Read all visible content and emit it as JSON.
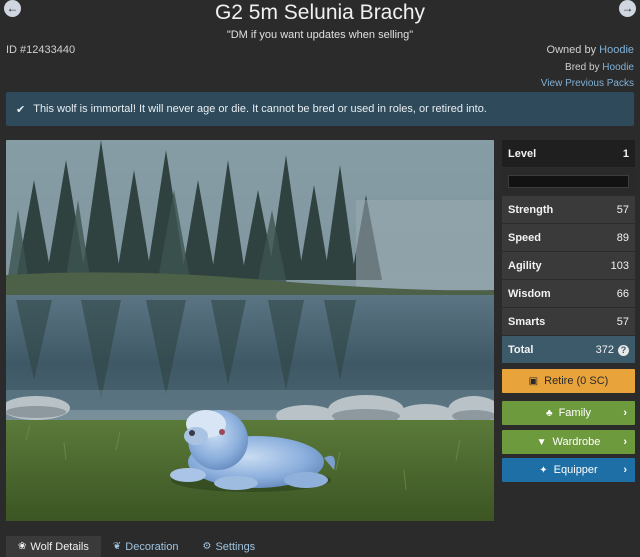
{
  "header": {
    "title": "G2 5m Selunia Brachy",
    "subtitle": "\"DM if you want updates when selling\"",
    "id_label": "ID #12433440",
    "owned_by_label": "Owned by",
    "owned_by_user": "Hoodie",
    "bred_by_label": "Bred by",
    "bred_by_user": "Hoodie",
    "previous_packs_link": "View Previous Packs",
    "prev_icon": "left-arrow-circle-icon",
    "next_icon": "right-arrow-circle-icon"
  },
  "alert": {
    "icon": "check-icon",
    "text": "This wolf is immortal! It will never age or die. It cannot be bred or used in roles, or retired into."
  },
  "stats": {
    "level_label": "Level",
    "level_value": "1",
    "xp_progress": 0,
    "strength_label": "Strength",
    "strength_value": "57",
    "speed_label": "Speed",
    "speed_value": "89",
    "agility_label": "Agility",
    "agility_value": "103",
    "wisdom_label": "Wisdom",
    "wisdom_value": "66",
    "smarts_label": "Smarts",
    "smarts_value": "57",
    "total_label": "Total",
    "total_value": "372"
  },
  "actions": {
    "retire": "Retire (0 SC)",
    "family": "Family",
    "wardrobe": "Wardrobe",
    "equipper": "Equipper"
  },
  "tabs": {
    "wolf_details": "Wolf Details",
    "decoration": "Decoration",
    "settings": "Settings"
  },
  "colors": {
    "background": "#2b2b2b",
    "alert_bg": "#2f4a5a",
    "retire": "#e8a33a",
    "green_action": "#6e9a3e",
    "equipper": "#1e6fa6",
    "link": "#7fb0d6"
  }
}
